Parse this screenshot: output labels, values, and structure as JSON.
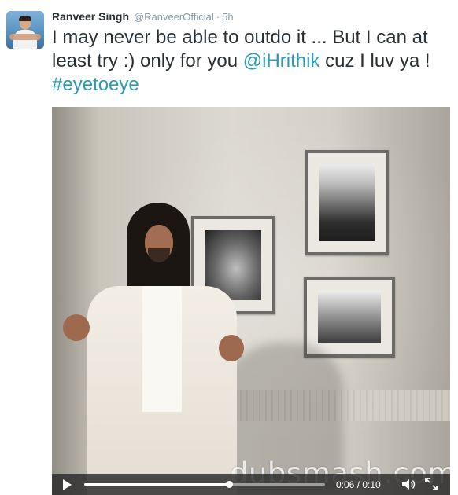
{
  "tweet": {
    "author": {
      "name": "Ranveer Singh",
      "handle": "@RanveerOfficial",
      "separator": "·",
      "time": "5h",
      "avatar_icon": "profile-avatar"
    },
    "text_parts": [
      {
        "text": "I may never be able to outdo it ... But I can at least try :) only for you ",
        "type": "text"
      },
      {
        "text": "@iHrithik",
        "type": "mention"
      },
      {
        "text": " cuz I luv ya ! ",
        "type": "text"
      },
      {
        "text": "#eyetoeye",
        "type": "hashtag"
      }
    ],
    "link_color": "#2b9bb4"
  },
  "video": {
    "watermark": "dubsmash.com",
    "time_readout": "0:06 / 0:10",
    "progress": 0.6,
    "icons": [
      "play-icon",
      "volume-icon",
      "fullscreen-icon"
    ]
  }
}
